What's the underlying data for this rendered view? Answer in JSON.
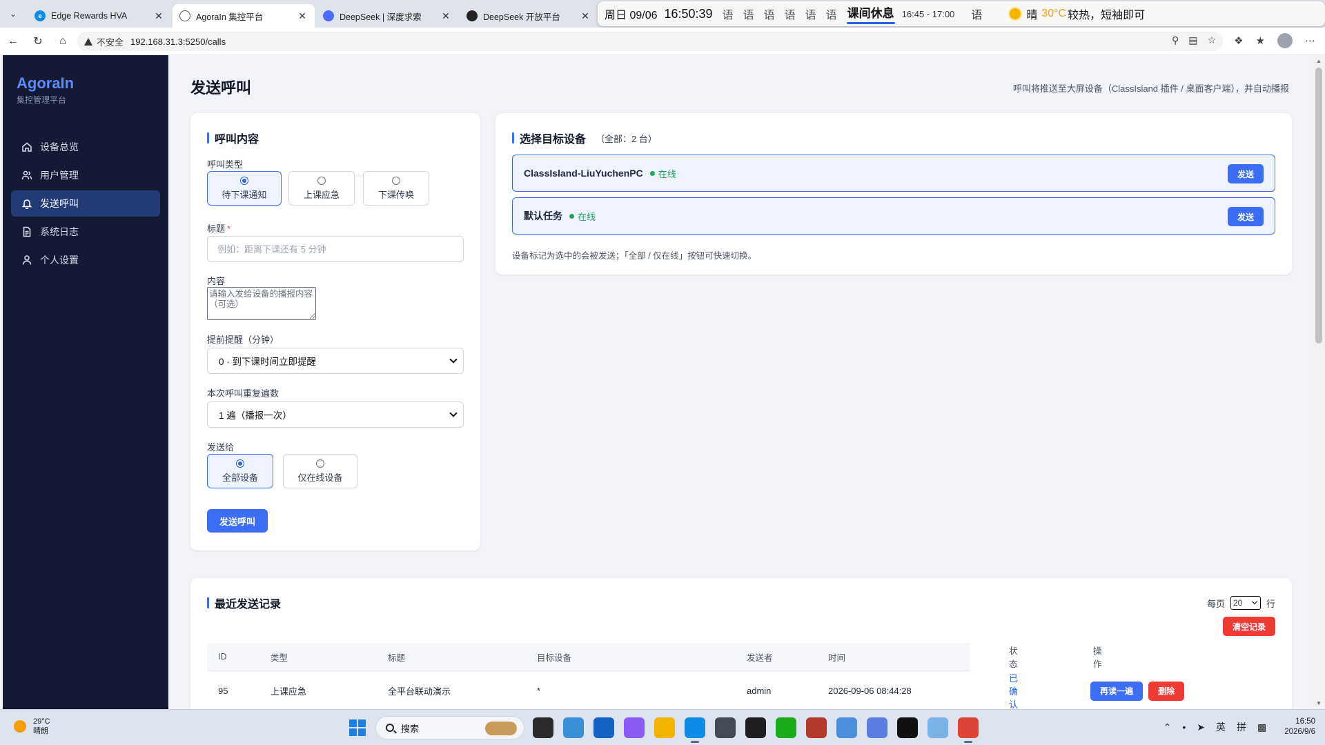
{
  "browser": {
    "tabs": [
      {
        "title": "Edge Rewards HVA",
        "color": "#0e8de8"
      },
      {
        "title": "AgoraIn 集控平台",
        "color": "#555555"
      },
      {
        "title": "DeepSeek | 深度求索",
        "color": "#4d6bfe"
      },
      {
        "title": "DeepSeek 开放平台",
        "color": "#222222"
      }
    ],
    "insecure_label": "不安全",
    "url": "192.168.31.3:5250/calls"
  },
  "classisland": {
    "date": "周日 09/06",
    "time": "16:50:39",
    "schedule_items": [
      "语",
      "语",
      "语",
      "语",
      "语",
      "语"
    ],
    "current_class": "课间休息",
    "current_range": "16:45 - 17:00",
    "next_class": "语",
    "weather_condition": "晴",
    "weather_temp": "30°C",
    "weather_tip": "较热，短袖即可"
  },
  "sidebar": {
    "brand_title": "AgoraIn",
    "brand_subtitle": "集控管理平台",
    "items": [
      {
        "label": "设备总览",
        "icon": "home-icon"
      },
      {
        "label": "用户管理",
        "icon": "users-icon"
      },
      {
        "label": "发送呼叫",
        "icon": "bell-icon"
      },
      {
        "label": "系统日志",
        "icon": "document-icon"
      },
      {
        "label": "个人设置",
        "icon": "user-icon"
      }
    ],
    "active_index": 2
  },
  "page": {
    "title": "发送呼叫",
    "hint": "呼叫将推送至大屏设备（ClassIsland 插件 / 桌面客户端），并自动播报"
  },
  "call_form": {
    "heading": "呼叫内容",
    "type_label": "呼叫类型",
    "type_options": [
      "待下课通知",
      "上课应急",
      "下课传唤"
    ],
    "type_selected": 0,
    "title_label": "标题",
    "title_required_mark": "*",
    "title_placeholder": "例如：距离下课还有 5 分钟",
    "content_label": "内容",
    "content_placeholder": "请输入发给设备的播报内容（可选）",
    "advance_label": "提前提醒（分钟）",
    "advance_value": "0 · 到下课时间立即提醒",
    "repeat_label": "本次呼叫重复遍数",
    "repeat_value": "1 遍（播报一次）",
    "send_to_label": "发送给",
    "send_to_options": [
      "全部设备",
      "仅在线设备"
    ],
    "send_to_selected": 0,
    "submit_label": "发送呼叫"
  },
  "devices": {
    "heading": "选择目标设备",
    "count_label": "（全部：2 台）",
    "items": [
      {
        "name": "ClassIsland-LiuYuchenPC",
        "status": "在线"
      },
      {
        "name": "默认任务",
        "status": "在线"
      }
    ],
    "send_label": "发送",
    "note": "设备标记为选中的会被发送；「全部 / 仅在线」按钮可快速切换。"
  },
  "records": {
    "heading": "最近发送记录",
    "per_page_prefix": "每页",
    "per_page_value": "20",
    "per_page_suffix": "行",
    "clear_label": "清空记录",
    "columns": [
      "ID",
      "类型",
      "标题",
      "目标设备",
      "发送者",
      "时间",
      "状态",
      "操作"
    ],
    "rows": [
      {
        "id": "95",
        "type": "上课应急",
        "title": "全平台联动演示",
        "target": "*",
        "sender": "admin",
        "time": "2026-09-06 08:44:28",
        "status": "已确认",
        "actions": [
          "再读一遍",
          "删除"
        ]
      }
    ]
  },
  "taskbar": {
    "weather_temp": "29°C",
    "weather_desc": "晴朗",
    "search_label": "搜索",
    "ime_lang": "英",
    "ime_mode": "拼",
    "clock_time": "16:50",
    "clock_date": "2026/9/6"
  },
  "colors": {
    "sidebar_bg": "#141a33",
    "accent": "#3b6ef5",
    "online": "#22a355",
    "danger": "#ef3b36"
  }
}
